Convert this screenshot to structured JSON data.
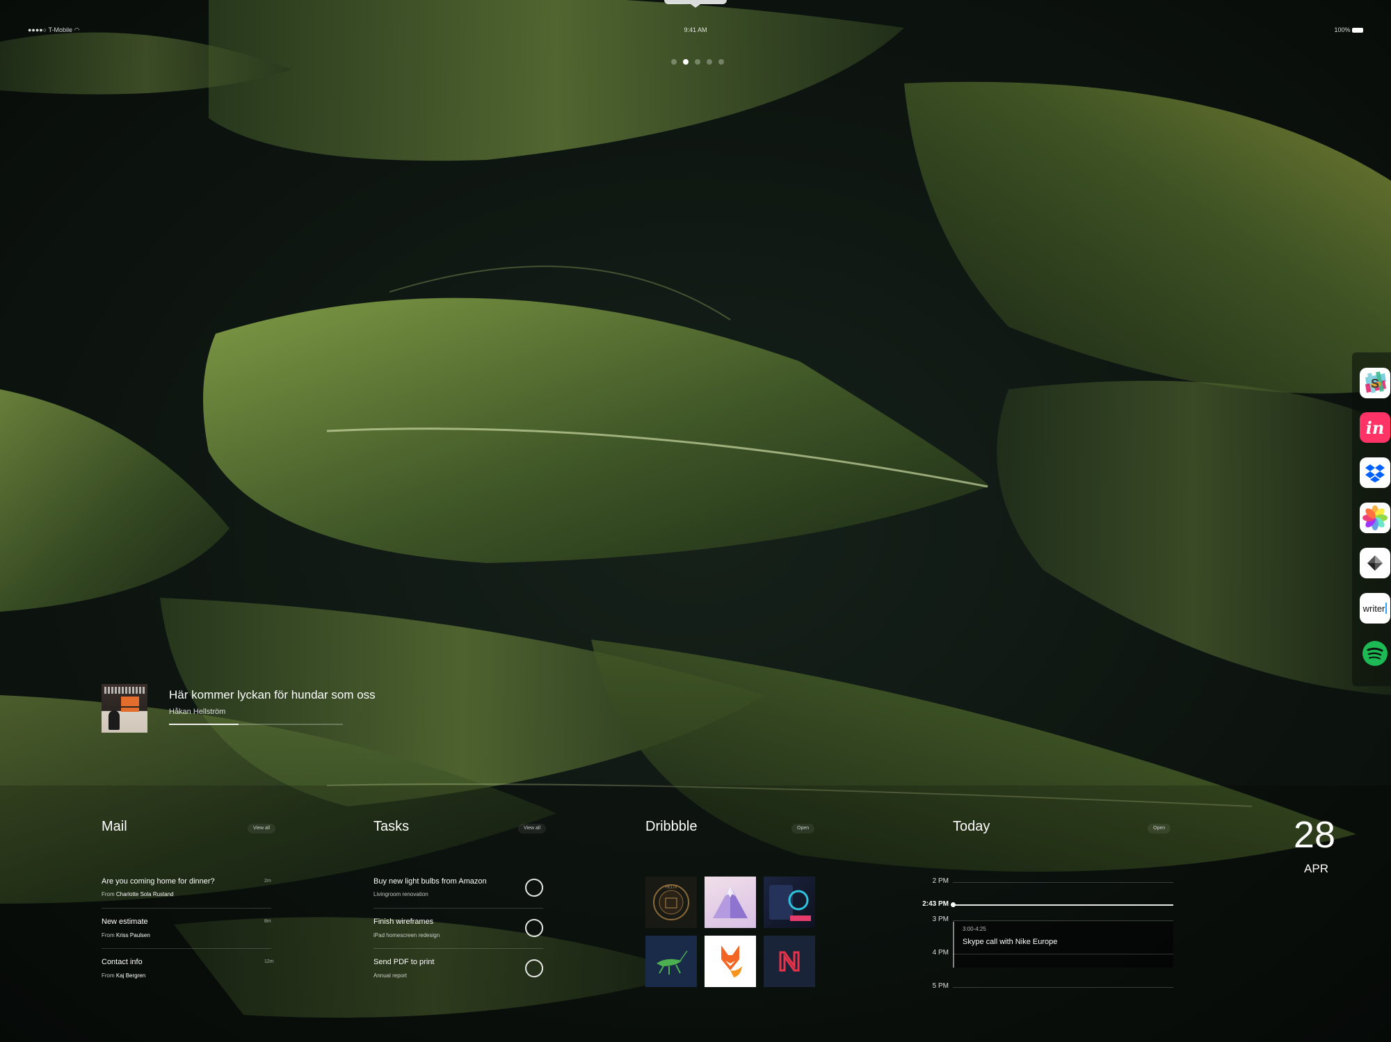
{
  "status_bar": {
    "carrier": "T-Mobile",
    "time": "9:41 AM",
    "battery": "100%"
  },
  "page_dots": {
    "count": 5,
    "active": 1
  },
  "dock": {
    "apps": [
      {
        "name": "Slack",
        "icon": "slack-icon"
      },
      {
        "name": "InVision",
        "icon": "invision-icon",
        "label": "in"
      },
      {
        "name": "Dropbox",
        "icon": "dropbox-icon"
      },
      {
        "name": "Photos",
        "icon": "photos-icon"
      },
      {
        "name": "Sketch",
        "icon": "sketch-icon"
      },
      {
        "name": "Writer",
        "icon": "writer-icon",
        "label": "writer"
      },
      {
        "name": "Spotify",
        "icon": "spotify-icon"
      }
    ]
  },
  "now_playing": {
    "title": "Här kommer lyckan för hundar som oss",
    "artist": "Håkan Hellström",
    "progress": 0.4
  },
  "mail": {
    "title": "Mail",
    "view_all": "View all",
    "items": [
      {
        "subject": "Are you coming home for dinner?",
        "from_label": "From",
        "from": "Charlotte Sola Rustand",
        "time": "2m"
      },
      {
        "subject": "New estimate",
        "from_label": "From",
        "from": "Kriss Paulsen",
        "time": "8m"
      },
      {
        "subject": "Contact info",
        "from_label": "From",
        "from": "Kaj Bergren",
        "time": "12m"
      }
    ]
  },
  "tasks": {
    "title": "Tasks",
    "view_all": "View all",
    "items": [
      {
        "title": "Buy new light bulbs from Amazon",
        "project": "Livingroom renovation"
      },
      {
        "title": "Finish wireframes",
        "project": "iPad homescreen redesign"
      },
      {
        "title": "Send PDF to print",
        "project": "Annual report"
      }
    ]
  },
  "dribbble": {
    "title": "Dribbble",
    "open": "Open",
    "shots": [
      "helix",
      "mountain",
      "dashboard",
      "cricket",
      "fox",
      "n-logo"
    ],
    "helix_text": "HELIX"
  },
  "today": {
    "title": "Today",
    "open": "Open",
    "hours": [
      "2 PM",
      "2:43 PM",
      "3 PM",
      "4 PM",
      "5 PM"
    ],
    "event": {
      "time": "3:00-4:25",
      "title": "Skype call with Nike Europe"
    },
    "date_day": "28",
    "date_month": "APR"
  },
  "colors": {
    "invision": "#ff3366",
    "spotify": "#1db954",
    "dropbox": "#0061ff",
    "fox": "#f26522"
  }
}
